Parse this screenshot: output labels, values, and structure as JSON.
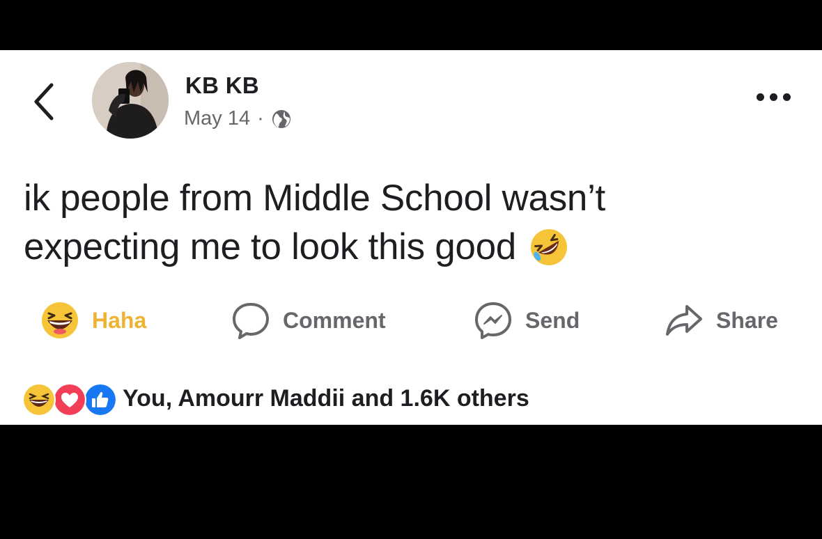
{
  "post": {
    "author": "KB KB",
    "date": "May 14",
    "separator": "·",
    "audience_icon": "globe-icon",
    "text_line1": "ik people from Middle School wasn’t",
    "text_line2": "expecting me to look this good"
  },
  "actions": {
    "haha_label": "Haha",
    "comment_label": "Comment",
    "send_label": "Send",
    "share_label": "Share"
  },
  "reactions": {
    "summary": "You, Amourr Maddii and 1.6K others",
    "icons": [
      "haha-icon",
      "love-icon",
      "like-icon"
    ]
  },
  "colors": {
    "haha_yellow": "#f0b232",
    "love_red": "#f33e58",
    "like_blue": "#1877f2",
    "meta_gray": "#65676b",
    "text": "#1c1e21"
  }
}
